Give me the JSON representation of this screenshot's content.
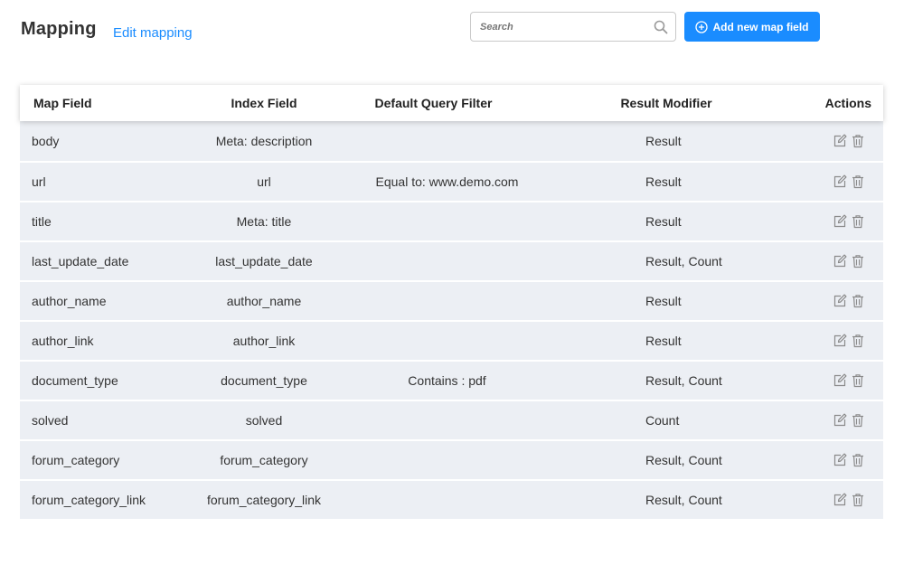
{
  "header": {
    "title": "Mapping",
    "edit_link": "Edit mapping",
    "search_placeholder": "Search",
    "search_icon": "search-icon",
    "add_button": "Add new map field",
    "add_icon": "plus-circle-icon"
  },
  "table": {
    "columns": [
      "Map Field",
      "Index Field",
      "Default Query Filter",
      "Result Modifier",
      "Actions"
    ],
    "rows": [
      {
        "map": "body",
        "index": "Meta: description",
        "filter": "",
        "modifier": "Result"
      },
      {
        "map": "url",
        "index": "url",
        "filter": "Equal to: www.demo.com",
        "modifier": "Result"
      },
      {
        "map": "title",
        "index": "Meta: title",
        "filter": "",
        "modifier": "Result"
      },
      {
        "map": "last_update_date",
        "index": "last_update_date",
        "filter": "",
        "modifier": "Result, Count"
      },
      {
        "map": "author_name",
        "index": "author_name",
        "filter": "",
        "modifier": "Result"
      },
      {
        "map": "author_link",
        "index": "author_link",
        "filter": "",
        "modifier": "Result"
      },
      {
        "map": "document_type",
        "index": "document_type",
        "filter": "Contains : pdf",
        "modifier": "Result, Count"
      },
      {
        "map": "solved",
        "index": "solved",
        "filter": "",
        "modifier": "Count"
      },
      {
        "map": "forum_category",
        "index": "forum_category",
        "filter": "",
        "modifier": "Result, Count"
      },
      {
        "map": "forum_category_link",
        "index": "forum_category_link",
        "filter": "",
        "modifier": "Result, Count"
      }
    ],
    "action_icons": [
      "edit-icon",
      "trash-icon"
    ]
  },
  "colors": {
    "accent": "#1a8cff",
    "row_background": "#eceff4",
    "icon_gray": "#8a8a8a"
  }
}
